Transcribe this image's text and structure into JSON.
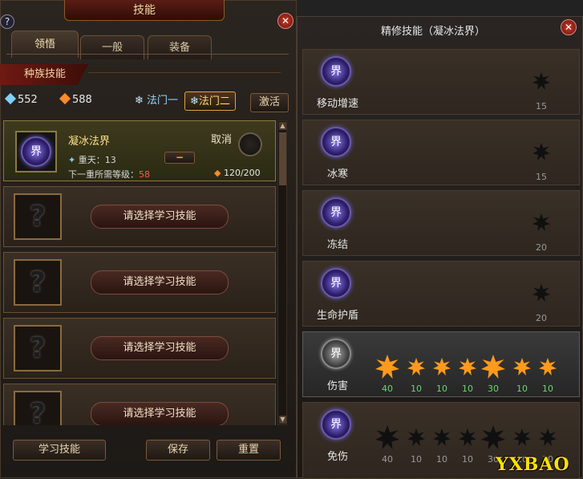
{
  "window": {
    "title": "技能",
    "help_glyph": "?",
    "close_glyph": "✕"
  },
  "tabs": [
    {
      "label": "领悟"
    },
    {
      "label": "一般"
    },
    {
      "label": "装备"
    }
  ],
  "race_skill_label": "种族技能",
  "stats": {
    "blue_value": "552",
    "orange_value": "588"
  },
  "doors": [
    {
      "label": "法门一"
    },
    {
      "label": "法门二"
    }
  ],
  "activate_label": "激活",
  "selected_skill": {
    "icon_glyph": "界",
    "name": "凝冰法界",
    "cancel_label": "取消",
    "level_text": "重天：13",
    "minus_label": "−",
    "next_level_label": "下一重所需等级：",
    "next_level_value": "58",
    "progress_text": "120/200"
  },
  "empty_slots": [
    {
      "placeholder": "?",
      "button": "请选择学习技能"
    },
    {
      "placeholder": "?",
      "button": "请选择学习技能"
    },
    {
      "placeholder": "?",
      "button": "请选择学习技能"
    },
    {
      "placeholder": "?",
      "button": "请选择学习技能"
    }
  ],
  "bottom_buttons": {
    "learn": "学习技能",
    "save": "保存",
    "reset": "重置"
  },
  "refine": {
    "title": "精修技能（凝冰法界）",
    "close_glyph": "✕",
    "rows": [
      {
        "label": "移动增速",
        "icon": "界",
        "value": "15"
      },
      {
        "label": "冰寒",
        "icon": "界",
        "value": "15"
      },
      {
        "label": "冻结",
        "icon": "界",
        "value": "20"
      },
      {
        "label": "生命护盾",
        "icon": "界",
        "value": "20"
      }
    ],
    "damage": {
      "label": "伤害",
      "icon": "界",
      "values": [
        "40",
        "10",
        "10",
        "10",
        "30",
        "10",
        "10"
      ]
    },
    "immune": {
      "label": "免伤",
      "icon": "界",
      "values": [
        "40",
        "10",
        "10",
        "10",
        "30",
        "10",
        "10"
      ]
    }
  },
  "watermark": "YXBAO"
}
